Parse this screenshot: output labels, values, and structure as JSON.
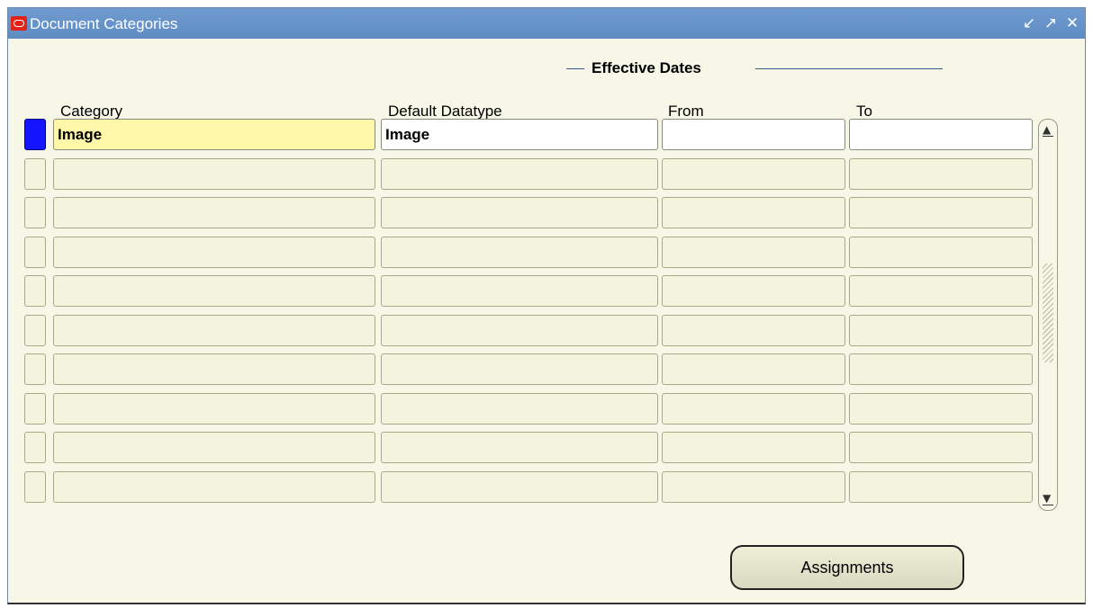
{
  "window": {
    "title": "Document Categories",
    "controls": [
      "minimize-icon",
      "maximize-icon",
      "close-icon"
    ]
  },
  "group": {
    "effective_dates_label": "Effective Dates"
  },
  "table": {
    "columns": {
      "category": "Category",
      "default_datatype": "Default Datatype",
      "from": "From",
      "to": "To"
    },
    "rows": [
      {
        "category": "Image",
        "default_datatype": "Image",
        "from": "",
        "to": ""
      },
      {
        "category": "",
        "default_datatype": "",
        "from": "",
        "to": ""
      },
      {
        "category": "",
        "default_datatype": "",
        "from": "",
        "to": ""
      },
      {
        "category": "",
        "default_datatype": "",
        "from": "",
        "to": ""
      },
      {
        "category": "",
        "default_datatype": "",
        "from": "",
        "to": ""
      },
      {
        "category": "",
        "default_datatype": "",
        "from": "",
        "to": ""
      },
      {
        "category": "",
        "default_datatype": "",
        "from": "",
        "to": ""
      },
      {
        "category": "",
        "default_datatype": "",
        "from": "",
        "to": ""
      },
      {
        "category": "",
        "default_datatype": "",
        "from": "",
        "to": ""
      },
      {
        "category": "",
        "default_datatype": "",
        "from": "",
        "to": ""
      }
    ]
  },
  "buttons": {
    "assignments": "Assignments"
  },
  "colors": {
    "titlebar": "#6f9bd0",
    "form_background": "#f7f7e7",
    "current_field": "#fff8a8",
    "record_indicator_active": "#1414ff"
  }
}
